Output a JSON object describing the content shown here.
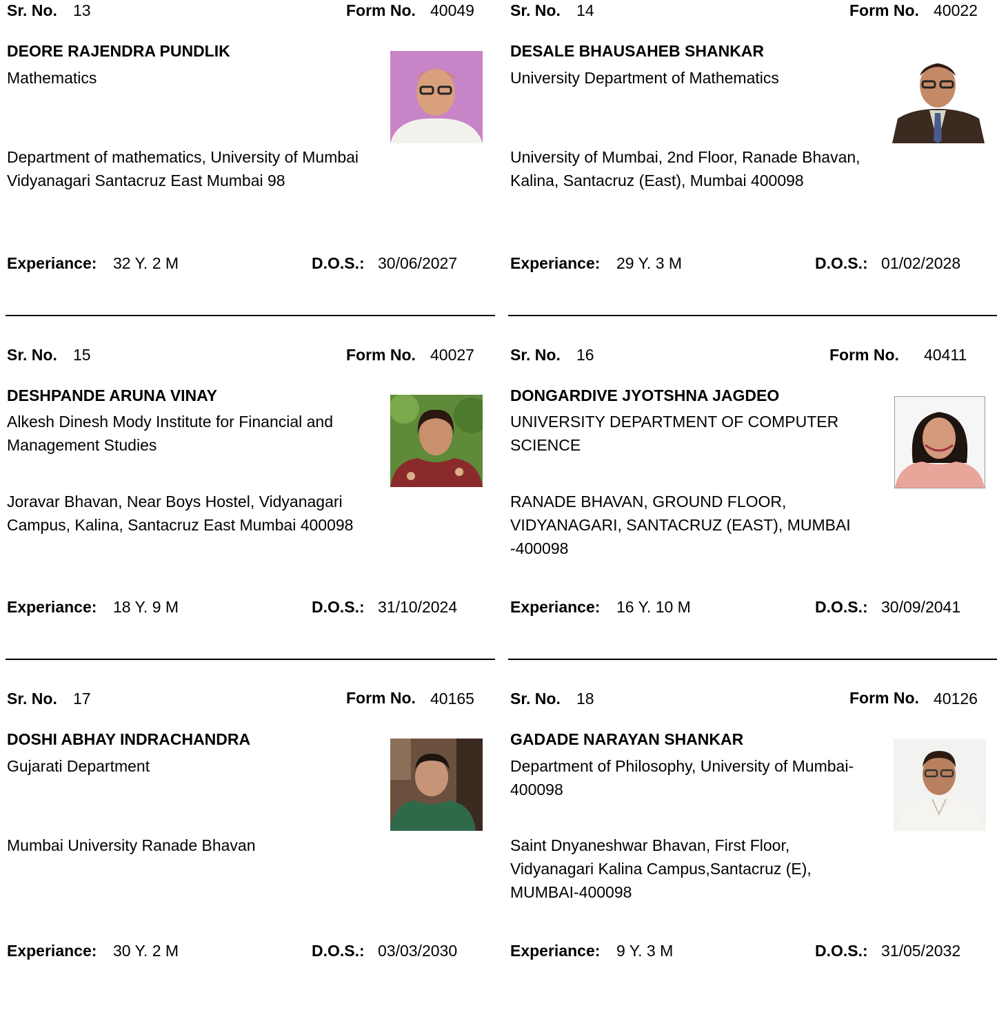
{
  "labels": {
    "sr_no": "Sr. No.",
    "form_no": "Form No.",
    "experience": "Experiance:",
    "dos": "D.O.S.:"
  },
  "cards": [
    {
      "sr_no": "13",
      "form_no": "40049",
      "name": "DEORE RAJENDRA PUNDLIK",
      "department": "Mathematics",
      "address": "Department of mathematics, University of Mumbai Vidyanagari Santacruz East Mumbai 98",
      "experience": "32 Y. 2 M",
      "dos": "30/06/2027",
      "photo_bg": "#c07ac0"
    },
    {
      "sr_no": "14",
      "form_no": "40022",
      "name": "DESALE BHAUSAHEB SHANKAR",
      "department": "University Department of Mathematics",
      "address": "University of Mumbai, 2nd Floor, Ranade Bhavan, Kalina, Santacruz (East), Mumbai 400098",
      "experience": "29 Y. 3 M",
      "dos": "01/02/2028",
      "photo_bg": "#ffffff"
    },
    {
      "sr_no": "15",
      "form_no": "40027",
      "name": "DESHPANDE ARUNA VINAY",
      "department": "Alkesh Dinesh Mody Institute for Financial and Management Studies",
      "address": "Joravar Bhavan, Near Boys Hostel, Vidyanagari Campus, Kalina, Santacruz East Mumbai 400098",
      "experience": "18 Y. 9 M",
      "dos": "31/10/2024",
      "photo_bg": "#5f8a3a"
    },
    {
      "sr_no": "16",
      "form_no": "40411",
      "name": "DONGARDIVE JYOTSHNA JAGDEO",
      "department": "UNIVERSITY DEPARTMENT OF COMPUTER SCIENCE",
      "address": "RANADE BHAVAN, GROUND FLOOR, VIDYANAGARI, SANTACRUZ (EAST), MUMBAI -400098",
      "experience": "16 Y. 10 M",
      "dos": "30/09/2041",
      "photo_bg": "#f6f6f6"
    },
    {
      "sr_no": "17",
      "form_no": "40165",
      "name": "DOSHI ABHAY INDRACHANDRA",
      "department": "Gujarati Department",
      "address": "Mumbai University Ranade Bhavan",
      "experience": "30 Y. 2 M",
      "dos": "03/03/2030",
      "photo_bg": "#6b5040"
    },
    {
      "sr_no": "18",
      "form_no": "40126",
      "name": "GADADE NARAYAN SHANKAR",
      "department": "Department of Philosophy, University of Mumbai-400098",
      "address": "Saint Dnyaneshwar Bhavan, First Floor, Vidyanagari Kalina Campus,Santacruz (E), MUMBAI-400098",
      "experience": "9 Y. 3 M",
      "dos": "31/05/2032",
      "photo_bg": "#f2f2f0"
    }
  ]
}
